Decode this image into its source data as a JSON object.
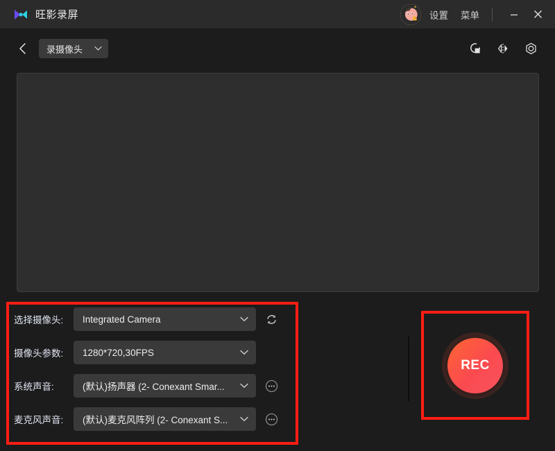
{
  "window": {
    "app_name": "旺影录屏",
    "logo_icon": "bowtie-logo-icon",
    "avatar_icon": "user-avatar",
    "settings_label": "设置",
    "menu_label": "菜单",
    "minimize_icon": "minimize-icon",
    "close_icon": "close-icon"
  },
  "toolbar": {
    "back_icon": "chevron-left-icon",
    "mode_label": "录摄像头",
    "mode_chevron_icon": "chevron-down-icon",
    "icons": [
      {
        "name": "rotate-icon",
        "title": "旋转"
      },
      {
        "name": "mirror-flip-icon",
        "title": "镜像"
      },
      {
        "name": "camera-settings-icon",
        "title": "摄像头设置"
      }
    ]
  },
  "preview": {
    "name": "camera-preview-area",
    "content": ""
  },
  "settings": {
    "rows": [
      {
        "label": "选择摄像头:",
        "value": "Integrated Camera",
        "name": "camera-select",
        "side_icon": "refresh-icon"
      },
      {
        "label": "摄像头参数:",
        "value": "1280*720,30FPS",
        "name": "camera-params-select",
        "side_icon": ""
      },
      {
        "label": "系统声音:",
        "value": "(默认)扬声器 (2- Conexant Smar...",
        "name": "system-audio-select",
        "side_icon": "more-options-icon"
      },
      {
        "label": "麦克风声音:",
        "value": "(默认)麦克风阵列 (2- Conexant S...",
        "name": "microphone-select",
        "side_icon": "more-options-icon"
      }
    ]
  },
  "record": {
    "label": "REC",
    "name": "record-button"
  },
  "colors": {
    "annotation": "#ff1d14",
    "titlebar_bg": "#2b2b2b",
    "window_bg": "#1c1c1c",
    "preview_bg": "#2e2e2e",
    "combo_bg": "#3a3a3a",
    "label_text": "#dfe3f0",
    "rec_gradient_start": "#ff6633",
    "rec_gradient_end": "#f8535f",
    "rec_ring": "#3b2320"
  }
}
